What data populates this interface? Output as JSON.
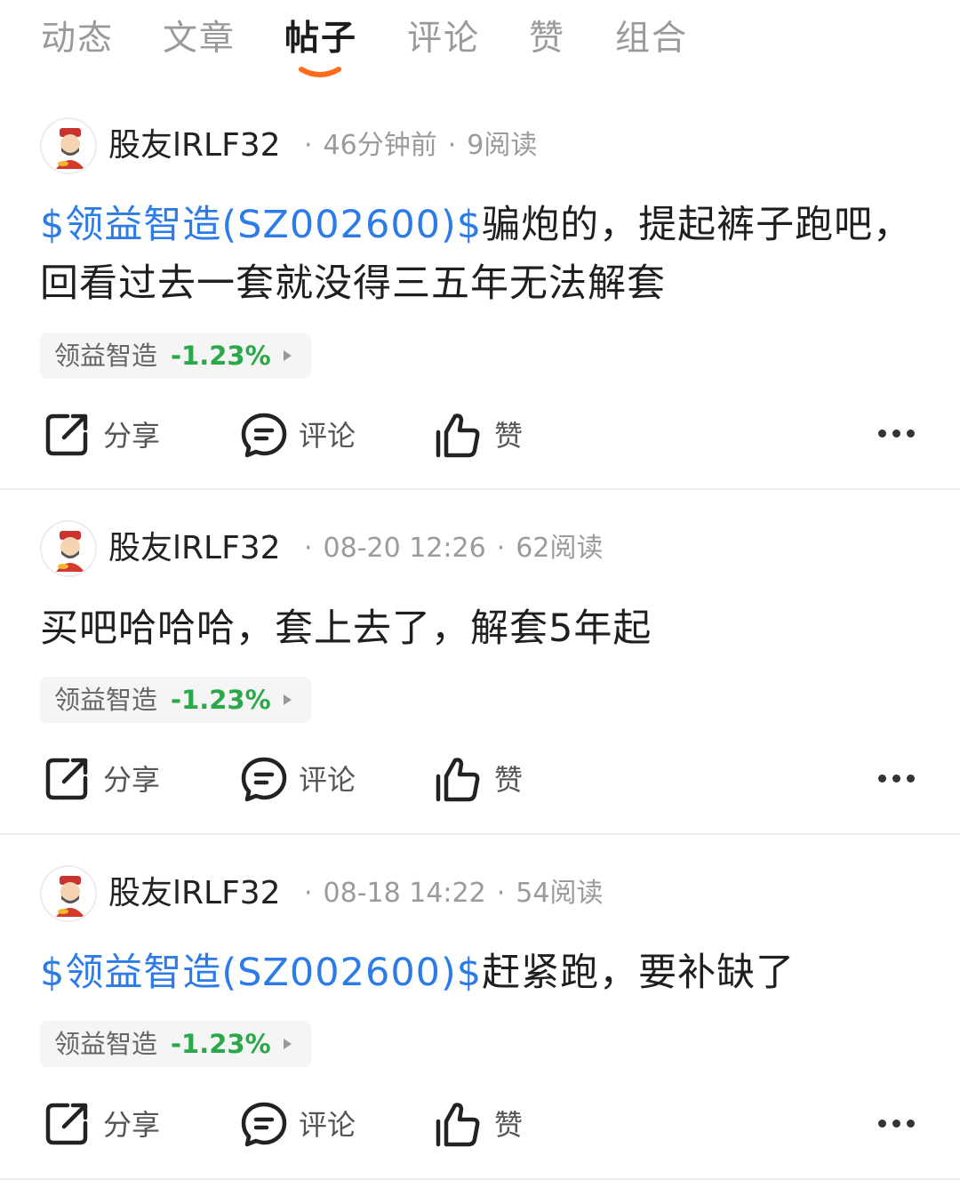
{
  "tabs": [
    {
      "label": "动态",
      "active": false
    },
    {
      "label": "文章",
      "active": false
    },
    {
      "label": "帖子",
      "active": true
    },
    {
      "label": "评论",
      "active": false
    },
    {
      "label": "赞",
      "active": false
    },
    {
      "label": "组合",
      "active": false
    }
  ],
  "accent_color": "#ff6b1a",
  "link_color": "#2d7ce6",
  "down_color": "#2aa84a",
  "posts": [
    {
      "author": "股友lRLF32",
      "time": "46分钟前",
      "reads": "9阅读",
      "content_link": "$领益智造(SZ002600)$",
      "content_text": "骗炮的，提起裤子跑吧，回看过去一套就没得三五年无法解套",
      "stock_name": "领益智造",
      "stock_change": "-1.23%",
      "share_label": "分享",
      "comment_label": "评论",
      "like_label": "赞"
    },
    {
      "author": "股友lRLF32",
      "time": "08-20 12:26",
      "reads": "62阅读",
      "content_link": "",
      "content_text": "买吧哈哈哈，套上去了，解套5年起",
      "stock_name": "领益智造",
      "stock_change": "-1.23%",
      "share_label": "分享",
      "comment_label": "评论",
      "like_label": "赞"
    },
    {
      "author": "股友lRLF32",
      "time": "08-18 14:22",
      "reads": "54阅读",
      "content_link": "$领益智造(SZ002600)$",
      "content_text": "赶紧跑，要补缺了",
      "stock_name": "领益智造",
      "stock_change": "-1.23%",
      "share_label": "分享",
      "comment_label": "评论",
      "like_label": "赞"
    }
  ]
}
